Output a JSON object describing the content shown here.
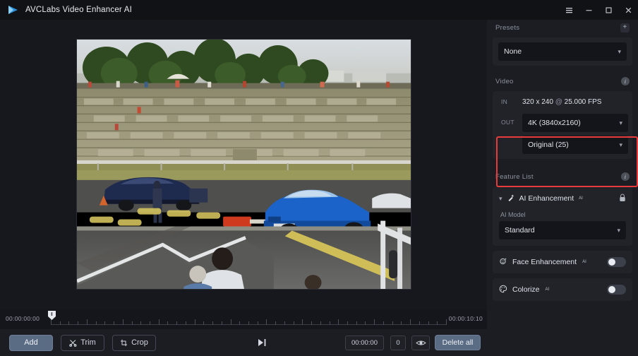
{
  "titlebar": {
    "app_title": "AVCLabs Video Enhancer AI",
    "logo_icon": "play-triangle-logo",
    "controls": [
      {
        "name": "menu-button",
        "icon": "hamburger-icon",
        "glyph": "☰"
      },
      {
        "name": "minimize-button",
        "icon": "minimize-icon",
        "glyph": "–"
      },
      {
        "name": "maximize-button",
        "icon": "maximize-icon",
        "glyph": "□"
      },
      {
        "name": "close-button",
        "icon": "close-icon",
        "glyph": "✕"
      }
    ]
  },
  "preview": {
    "alt": "drag racing video frame: blue sedan on track, grandstands and trees behind"
  },
  "timeline": {
    "start_time": "00:00:00:00",
    "end_time": "00:00:10:10",
    "playhead_icon": "playhead-marker"
  },
  "bottombar": {
    "add_label": "Add",
    "trim_label": "Trim",
    "crop_label": "Crop",
    "play_icon": "play-to-end-icon",
    "time_value": "00:00:00",
    "count_value": "0",
    "preview_icon": "eye-icon",
    "delete_all_label": "Delete all"
  },
  "presets": {
    "section_label": "Presets",
    "add_preset_icon": "plus-icon",
    "add_preset_glyph": "+",
    "selected": "None"
  },
  "video": {
    "section_label": "Video",
    "info_icon": "info-icon",
    "in_tag": "IN",
    "in_resolution": "320 x 240",
    "in_at": "@",
    "in_fps": "25.000 FPS",
    "out_tag": "OUT",
    "out_resolution": "4K (3840x2160)",
    "out_framerate": "Original (25)",
    "highlight_color": "#e83b3b"
  },
  "feature_list": {
    "section_label": "Feature List",
    "info_icon": "info-icon",
    "ai_enhancement": {
      "label": "AI Enhancement",
      "superscript": "AI",
      "expand_icon": "chevron-down-icon",
      "feature_icon": "magic-wand-icon",
      "lock_icon": "lock-icon",
      "model_label": "AI Model",
      "model_value": "Standard"
    },
    "toggles": [
      {
        "label": "Face Enhancement",
        "superscript": "AI",
        "icon": "face-enhancement-icon",
        "state": "off"
      },
      {
        "label": "Colorize",
        "superscript": "AI",
        "icon": "colorize-palette-icon",
        "state": "off"
      }
    ]
  }
}
